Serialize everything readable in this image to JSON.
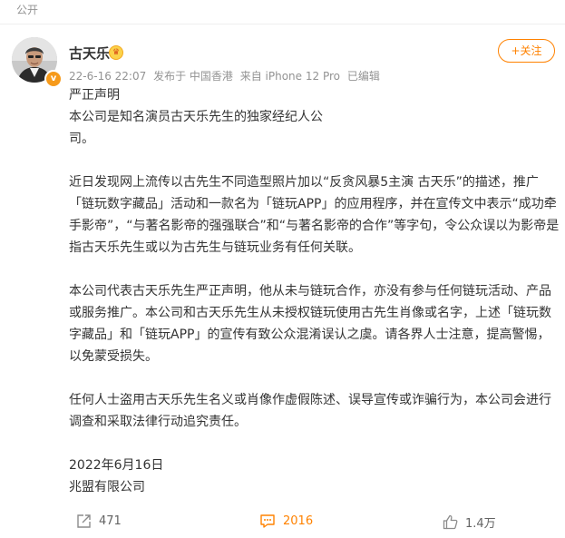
{
  "header": {
    "visibility": "公开"
  },
  "post": {
    "author": {
      "name": "古天乐",
      "vip_badge_glyph": "♛",
      "verified_glyph": "v"
    },
    "meta": {
      "date": "22-6-16 22:07",
      "location": "发布于 中国香港",
      "device": "来自 iPhone 12 Pro",
      "edited": "已编辑"
    },
    "follow_label": "+关注",
    "lines": [
      "严正声明",
      "本公司是知名演员古天乐先生的独家经纪人公",
      "司。",
      "",
      "近日发现网上流传以古先生不同造型照片加以“反贪风暴5主演 古天乐”的描述，推广",
      "「链玩数字藏品」活动和一款名为「链玩APP」的应用程序，并在宣传文中表示“成功牵",
      "手影帝”，“与著名影帝的强强联合”和“与著名影帝的合作”等字句，令公众误以为影帝是",
      "指古天乐先生或以为古先生与链玩业务有任何关联。",
      "",
      "本公司代表古天乐先生严正声明，他从未与链玩合作，亦没有参与任何链玩活动、产品",
      "或服务推广。本公司和古天乐先生从未授权链玩使用古先生肖像或名字，上述「链玩数",
      "字藏品」和「链玩APP」的宣传有致公众混淆误认之虞。请各界人士注意，提高警惕，",
      "以免蒙受损失。",
      "",
      "任何人士盗用古天乐先生名义或肖像作虚假陈述、误导宣传或诈骗行为，本公司会进行",
      "调查和采取法律行动追究责任。",
      "",
      "2022年6月16日",
      "兆盟有限公司"
    ]
  },
  "actions": {
    "repost_count": "471",
    "comment_count": "2016",
    "like_count": "1.4万"
  },
  "colors": {
    "accent": "#ff8200",
    "meta_text": "#939393",
    "body_text": "#333333"
  },
  "icons": {
    "repost": "share-arrow-icon",
    "comment": "comment-bubble-icon",
    "like": "thumbs-up-icon"
  }
}
